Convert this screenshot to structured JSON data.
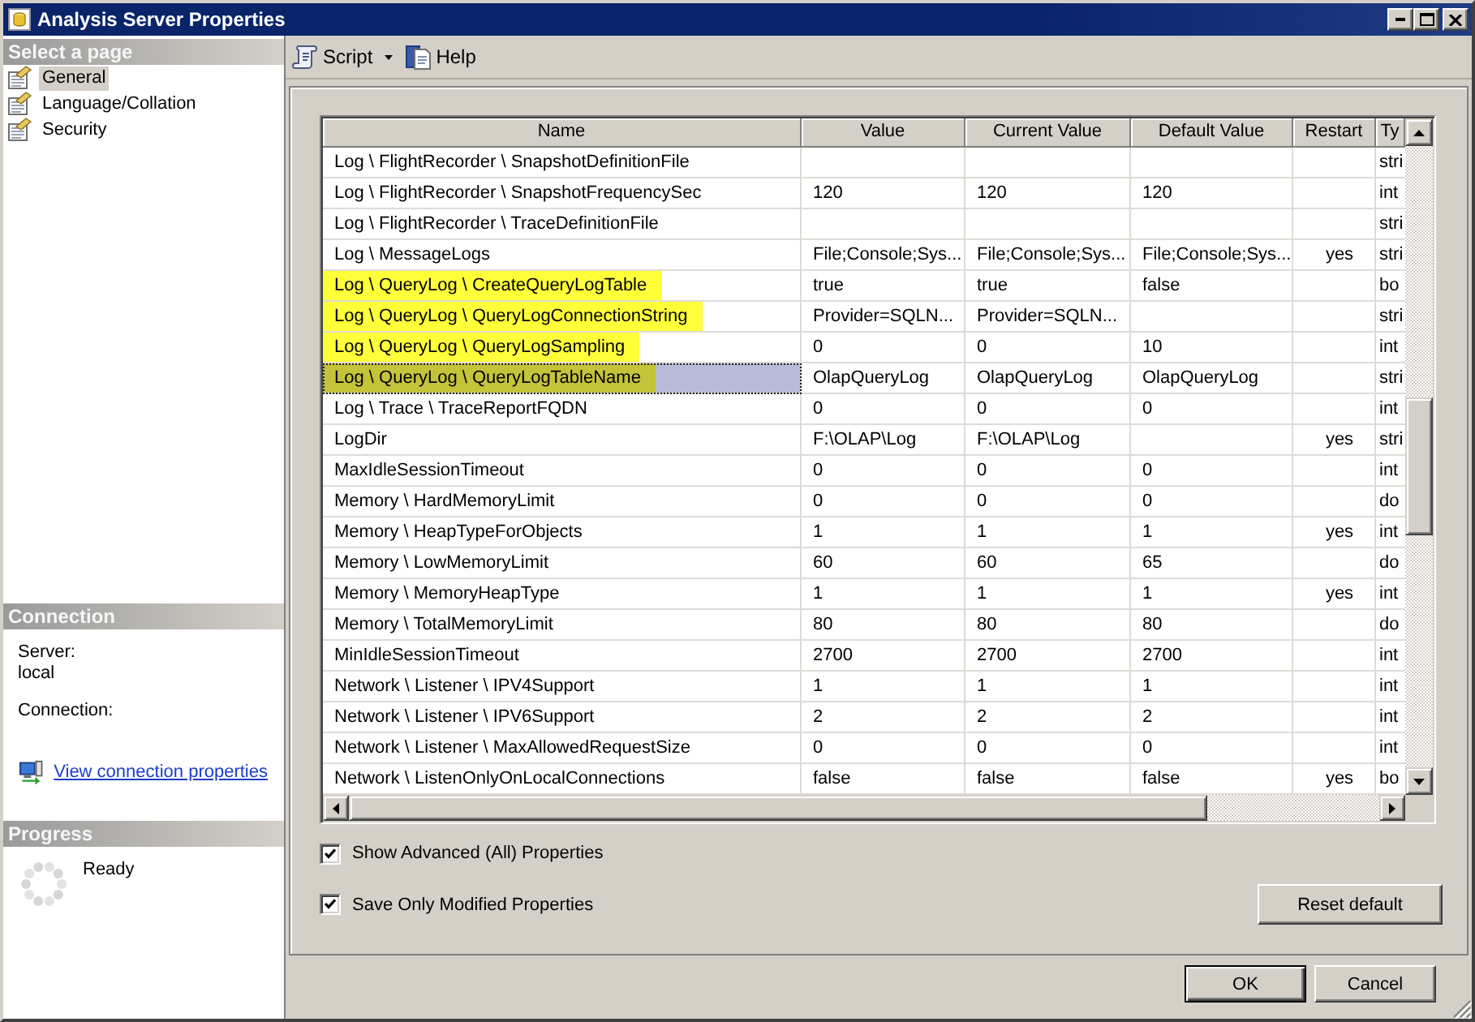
{
  "window": {
    "title": "Analysis Server Properties"
  },
  "select_page": {
    "header": "Select a page",
    "items": [
      {
        "label": "General",
        "selected": true
      },
      {
        "label": "Language/Collation",
        "selected": false
      },
      {
        "label": "Security",
        "selected": false
      }
    ]
  },
  "connection": {
    "header": "Connection",
    "server_label": "Server:",
    "server": "local",
    "connection_label": "Connection:",
    "link": "View connection properties"
  },
  "progress": {
    "header": "Progress",
    "status": "Ready"
  },
  "toolbar": [
    {
      "label": "Script",
      "kind": "dropdown"
    },
    {
      "label": "Help",
      "kind": "button"
    }
  ],
  "grid": {
    "columns": [
      "Name",
      "Value",
      "Current Value",
      "Default Value",
      "Restart",
      "Ty"
    ],
    "rows": [
      {
        "name": "Log \\ FlightRecorder \\ SnapshotDefinitionFile",
        "type": "stri",
        "highlighted": false,
        "selected": false
      },
      {
        "name": "Log \\ FlightRecorder \\ SnapshotFrequencySec",
        "value": "120",
        "current_value": "120",
        "default_value": "120",
        "type": "int",
        "highlighted": false,
        "selected": false
      },
      {
        "name": "Log \\ FlightRecorder \\ TraceDefinitionFile",
        "type": "stri",
        "highlighted": false,
        "selected": false
      },
      {
        "name": "Log \\ MessageLogs",
        "value": "File;Console;Sys...",
        "current_value": "File;Console;Sys...",
        "default_value": "File;Console;Sys...",
        "restart": "yes",
        "type": "stri",
        "highlighted": false,
        "selected": false
      },
      {
        "name": "Log \\ QueryLog \\ CreateQueryLogTable",
        "value": "true",
        "current_value": "true",
        "default_value": "false",
        "type": "bo",
        "highlighted": true,
        "selected": false
      },
      {
        "name": "Log \\ QueryLog \\ QueryLogConnectionString",
        "value": "Provider=SQLN...",
        "current_value": "Provider=SQLN...",
        "type": "stri",
        "highlighted": true,
        "selected": false
      },
      {
        "name": "Log \\ QueryLog \\ QueryLogSampling",
        "value": "0",
        "current_value": "0",
        "default_value": "10",
        "type": "int",
        "highlighted": true,
        "selected": false
      },
      {
        "name": "Log \\ QueryLog \\ QueryLogTableName",
        "value": "OlapQueryLog",
        "current_value": "OlapQueryLog",
        "default_value": "OlapQueryLog",
        "type": "stri",
        "highlighted": true,
        "selected": true
      },
      {
        "name": "Log \\ Trace \\ TraceReportFQDN",
        "value": "0",
        "current_value": "0",
        "default_value": "0",
        "type": "int",
        "highlighted": false,
        "selected": false
      },
      {
        "name": "LogDir",
        "value": "F:\\OLAP\\Log",
        "current_value": "F:\\OLAP\\Log",
        "restart": "yes",
        "type": "stri",
        "highlighted": false,
        "selected": false
      },
      {
        "name": "MaxIdleSessionTimeout",
        "value": "0",
        "current_value": "0",
        "default_value": "0",
        "type": "int",
        "highlighted": false,
        "selected": false
      },
      {
        "name": "Memory \\ HardMemoryLimit",
        "value": "0",
        "current_value": "0",
        "default_value": "0",
        "type": "do",
        "highlighted": false,
        "selected": false
      },
      {
        "name": "Memory \\ HeapTypeForObjects",
        "value": "1",
        "current_value": "1",
        "default_value": "1",
        "restart": "yes",
        "type": "int",
        "highlighted": false,
        "selected": false
      },
      {
        "name": "Memory \\ LowMemoryLimit",
        "value": "60",
        "current_value": "60",
        "default_value": "65",
        "type": "do",
        "highlighted": false,
        "selected": false
      },
      {
        "name": "Memory \\ MemoryHeapType",
        "value": "1",
        "current_value": "1",
        "default_value": "1",
        "restart": "yes",
        "type": "int",
        "highlighted": false,
        "selected": false
      },
      {
        "name": "Memory \\ TotalMemoryLimit",
        "value": "80",
        "current_value": "80",
        "default_value": "80",
        "type": "do",
        "highlighted": false,
        "selected": false
      },
      {
        "name": "MinIdleSessionTimeout",
        "value": "2700",
        "current_value": "2700",
        "default_value": "2700",
        "type": "int",
        "highlighted": false,
        "selected": false
      },
      {
        "name": "Network \\ Listener \\ IPV4Support",
        "value": "1",
        "current_value": "1",
        "default_value": "1",
        "type": "int",
        "highlighted": false,
        "selected": false
      },
      {
        "name": "Network \\ Listener \\ IPV6Support",
        "value": "2",
        "current_value": "2",
        "default_value": "2",
        "type": "int",
        "highlighted": false,
        "selected": false
      },
      {
        "name": "Network \\ Listener \\ MaxAllowedRequestSize",
        "value": "0",
        "current_value": "0",
        "default_value": "0",
        "type": "int",
        "highlighted": false,
        "selected": false
      },
      {
        "name": "Network \\ ListenOnlyOnLocalConnections",
        "value": "false",
        "current_value": "false",
        "default_value": "false",
        "restart": "yes",
        "type": "bo",
        "highlighted": false,
        "selected": false
      }
    ]
  },
  "options": [
    {
      "label": "Show Advanced (All) Properties",
      "checked": true
    },
    {
      "label": "Save Only Modified Properties",
      "checked": true
    }
  ],
  "reset_button": "Reset default",
  "buttons": [
    {
      "label": "OK",
      "default": true
    },
    {
      "label": "Cancel",
      "default": false
    }
  ]
}
